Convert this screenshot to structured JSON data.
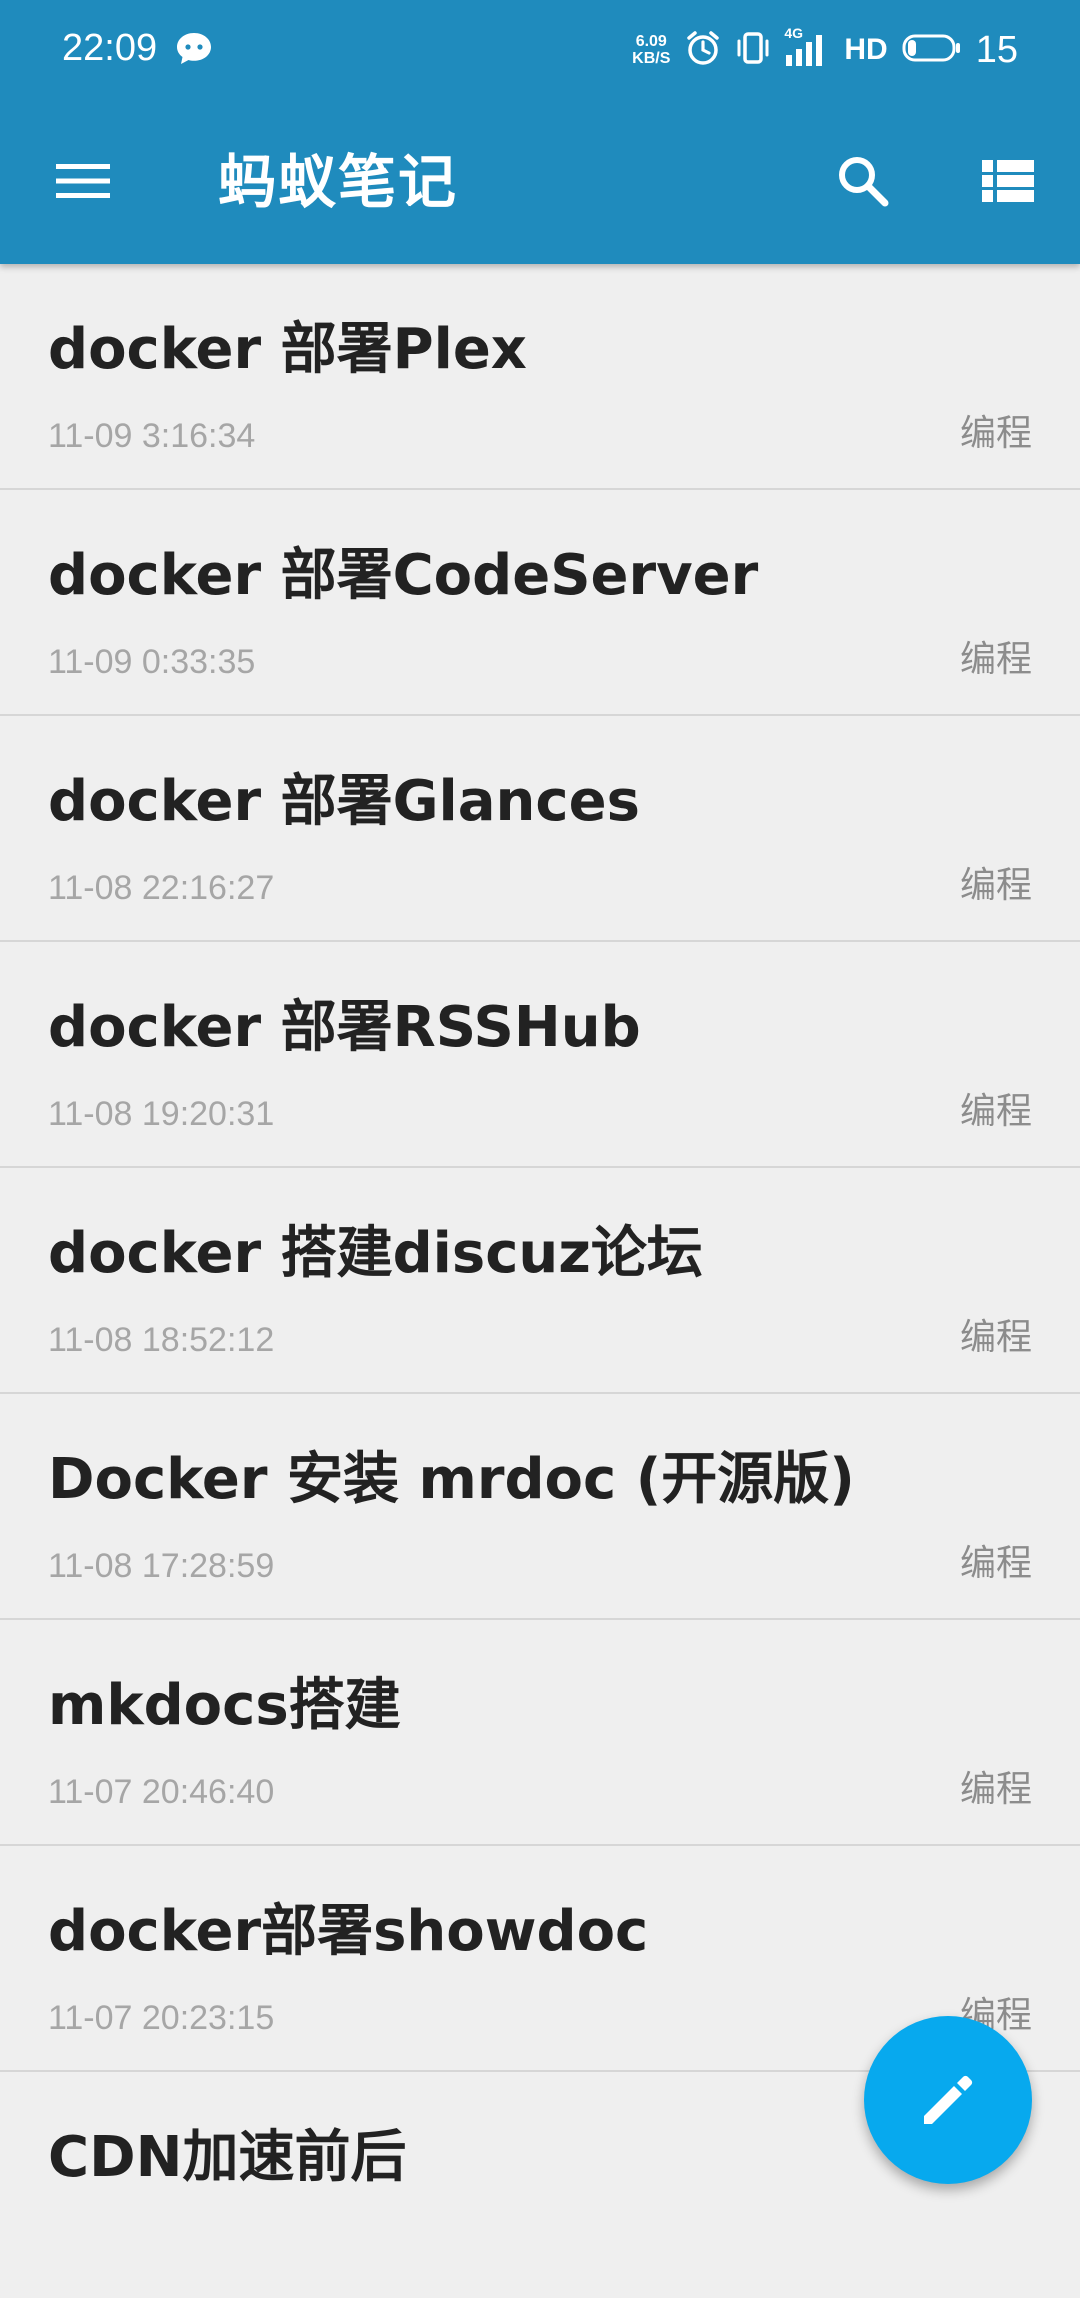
{
  "status_bar": {
    "time": "22:09",
    "net_speed_value": "6.09",
    "net_speed_unit": "KB/S",
    "network": "4G",
    "hd": "HD",
    "battery": "15",
    "icons": [
      "wechat-icon",
      "alarm-icon",
      "vibrate-icon",
      "signal-icon",
      "battery-icon"
    ]
  },
  "toolbar": {
    "title": "蚂蚁笔记",
    "icons": [
      "menu-icon",
      "search-icon",
      "list-view-icon"
    ]
  },
  "notes": [
    {
      "title": "docker 部署Plex",
      "time": "11-09 3:16:34",
      "category": "编程"
    },
    {
      "title": "docker 部署CodeServer",
      "time": "11-09 0:33:35",
      "category": "编程"
    },
    {
      "title": "docker 部署Glances",
      "time": "11-08 22:16:27",
      "category": "编程"
    },
    {
      "title": "docker 部署RSSHub",
      "time": "11-08 19:20:31",
      "category": "编程"
    },
    {
      "title": "docker 搭建discuz论坛",
      "time": "11-08 18:52:12",
      "category": "编程"
    },
    {
      "title": "Docker 安装 mrdoc (开源版)",
      "time": "11-08 17:28:59",
      "category": "编程"
    },
    {
      "title": "mkdocs搭建",
      "time": "11-07 20:46:40",
      "category": "编程"
    },
    {
      "title": "docker部署showdoc",
      "time": "11-07 20:23:15",
      "category": "编程"
    },
    {
      "title": "CDN加速前后",
      "time": "",
      "category": ""
    }
  ],
  "fab": {
    "icon": "pencil-icon"
  },
  "colors": {
    "app_bar": "#1f8bbd",
    "background": "#efefef",
    "fab": "#07a9ee",
    "title_text": "#222222",
    "meta_text": "#a6a6a6"
  }
}
